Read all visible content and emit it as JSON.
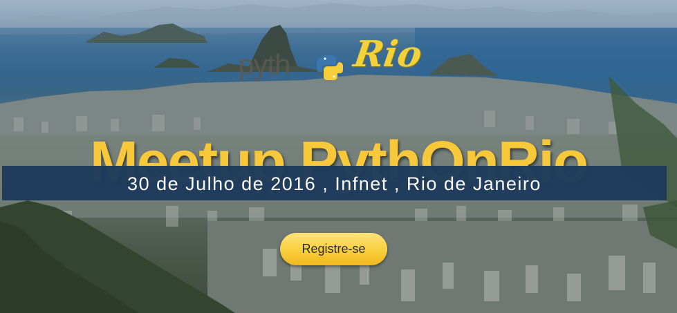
{
  "logo": {
    "python_text": "pyth",
    "on_text": "n",
    "rio_text": "Rio"
  },
  "hero": {
    "title": "Meetup PythOnRio",
    "subtitle": "30 de Julho de 2016 , Infnet , Rio de Janeiro",
    "register_label": "Registre-se"
  },
  "colors": {
    "title": "#f7c93a",
    "banner": "#1e3b5c",
    "button": "#f9cf3c",
    "logo_rio": "#f2d13a"
  },
  "icons": {
    "logo_snake": "python-snake-icon"
  }
}
